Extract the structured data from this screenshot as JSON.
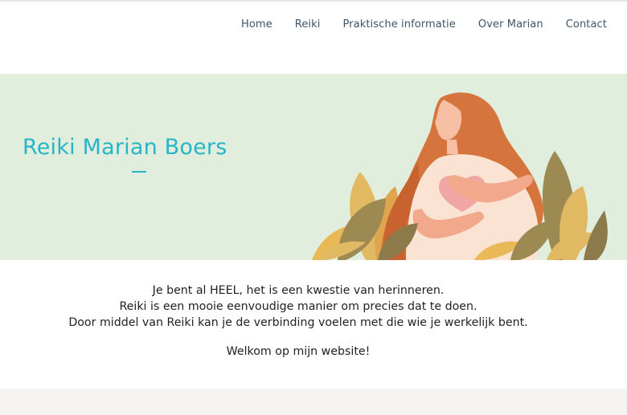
{
  "nav": {
    "items": [
      {
        "label": "Home"
      },
      {
        "label": "Reiki"
      },
      {
        "label": "Praktische informatie"
      },
      {
        "label": "Over Marian"
      },
      {
        "label": "Contact"
      }
    ]
  },
  "hero": {
    "title": "Reiki Marian Boers"
  },
  "intro": {
    "lines": [
      "Je bent al HEEL, het is een kwestie van herinneren.",
      "Reiki is een mooie eenvoudige manier om precies dat te doen.",
      "Door middel van Reiki kan je de verbinding voelen met die wie je werkelijk bent."
    ],
    "welcome": "Welkom op mijn website!"
  },
  "colors": {
    "accent": "#27b5c7",
    "hero_background": "#e2eedd",
    "nav_text": "#3f5466"
  },
  "illustration": {
    "subject": "woman-with-heart-illustration"
  }
}
